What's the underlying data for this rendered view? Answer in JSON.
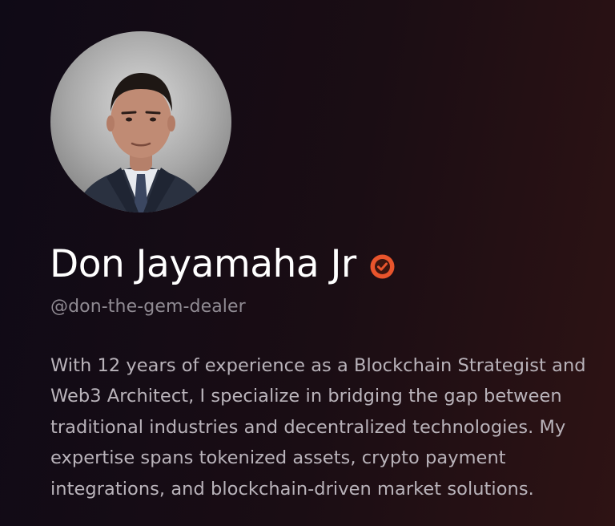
{
  "profile": {
    "name": "Don Jayamaha Jr",
    "verified": true,
    "verified_badge_color": "#e8542c",
    "handle": "@don-the-gem-dealer",
    "bio_lines": [
      "With 12 years of experience as a Blockchain Strategist and",
      "Web3 Architect, I specialize in bridging the gap between",
      "traditional industries and decentralized technologies. My",
      "expertise spans tokenized assets, crypto payment",
      "integrations, and blockchain-driven market solutions."
    ]
  },
  "icons": {
    "verified": "verified-check-badge"
  },
  "colors": {
    "background_left": "#0f0a16",
    "background_right": "#2e1314",
    "name_text": "#ffffff",
    "handle_text": "#8f8a92",
    "bio_text": "#b9b3ba"
  }
}
